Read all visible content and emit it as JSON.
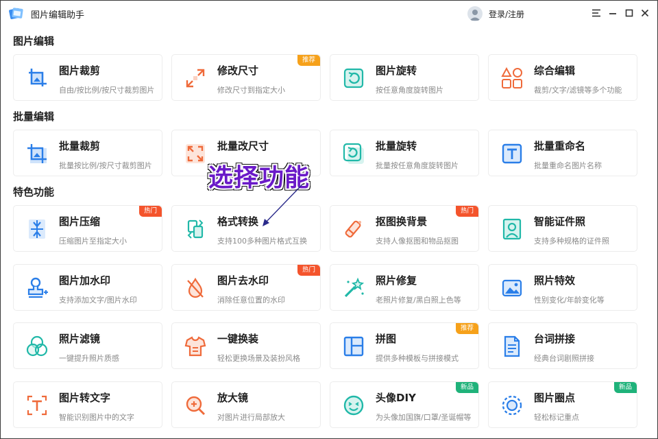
{
  "titlebar": {
    "app_title": "图片编辑助手",
    "login_label": "登录/注册"
  },
  "sections": {
    "image_edit": "图片编辑",
    "batch_edit": "批量编辑",
    "features": "特色功能"
  },
  "annotation": {
    "text": "选择功能"
  },
  "cards": {
    "crop": {
      "title": "图片裁剪",
      "desc": "自由/按比例/按尺寸裁剪图片"
    },
    "resize": {
      "title": "修改尺寸",
      "desc": "修改尺寸到指定大小",
      "badge": "推荐"
    },
    "rotate": {
      "title": "图片旋转",
      "desc": "按任意角度旋转图片"
    },
    "combo": {
      "title": "综合编辑",
      "desc": "裁剪/文字/滤镜等多个功能"
    },
    "batch_crop": {
      "title": "批量裁剪",
      "desc": "批量按比例/按尺寸裁剪图片"
    },
    "batch_resize": {
      "title": "批量改尺寸",
      "desc": ""
    },
    "batch_rotate": {
      "title": "批量旋转",
      "desc": "批量按任意角度旋转图片"
    },
    "batch_rename": {
      "title": "批量重命名",
      "desc": "批量重命名图片名称"
    },
    "compress": {
      "title": "图片压缩",
      "desc": "压缩图片至指定大小",
      "badge": "热门"
    },
    "convert": {
      "title": "格式转换",
      "desc": "支持100多种图片格式互换"
    },
    "cutout": {
      "title": "抠图换背景",
      "desc": "支持人像抠图和物品抠图",
      "badge": "热门"
    },
    "id_photo": {
      "title": "智能证件照",
      "desc": "支持多种规格的证件照"
    },
    "watermark_add": {
      "title": "图片加水印",
      "desc": "支持添加文字/图片水印"
    },
    "watermark_remove": {
      "title": "图片去水印",
      "desc": "消除任意位置的水印",
      "badge": "热门"
    },
    "restore": {
      "title": "照片修复",
      "desc": "老照片修复/黑白照上色等"
    },
    "effects": {
      "title": "照片特效",
      "desc": "性别变化/年龄变化等"
    },
    "filter": {
      "title": "照片滤镜",
      "desc": "一键提升照片质感"
    },
    "outfit": {
      "title": "一键换装",
      "desc": "轻松更换场景及装扮风格"
    },
    "collage": {
      "title": "拼图",
      "desc": "提供多种模板与拼接模式",
      "badge": "推荐"
    },
    "subtitle_stitch": {
      "title": "台词拼接",
      "desc": "经典台词剧照拼接"
    },
    "ocr": {
      "title": "图片转文字",
      "desc": "智能识别图片中的文字"
    },
    "magnifier": {
      "title": "放大镜",
      "desc": "对图片进行局部放大"
    },
    "avatar_diy": {
      "title": "头像DIY",
      "desc": "为头像加国旗/口罩/圣诞帽等",
      "badge": "新品"
    },
    "circle_mark": {
      "title": "图片圈点",
      "desc": "轻松标记重点",
      "badge": "新品"
    }
  },
  "colors": {
    "blue": "#2a7ee8",
    "orange": "#ef6a3a",
    "teal": "#20b8a8",
    "annotation": "#6a1ac8"
  }
}
